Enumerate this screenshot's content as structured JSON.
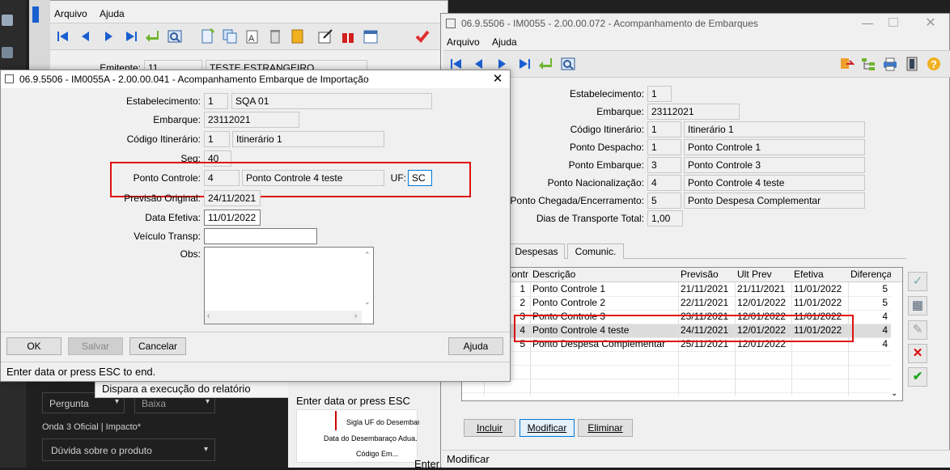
{
  "bg_window": {
    "menu": [
      "Arquivo",
      "Ajuda"
    ],
    "header_label": "Emitente:",
    "header_value": "11",
    "header_name": "TESTE ESTRANGEIRO"
  },
  "bottom_left": {
    "select1": "Pergunta",
    "select2": "Baixa",
    "section_label": "Onda 3 Oficial | Impacto*",
    "select3": "Dúvida sobre o produto",
    "tooltip": "Dispara a execução do relatório",
    "status_frag": "Enter data or press ESC",
    "flow1": "Sigla UF do Desembar...",
    "flow2": "Data do Desembaraço Adua...",
    "flow3": "Código Em...",
    "status_frag2": "Enter"
  },
  "dialog": {
    "title": "06.9.5506 - IM0055A - 2.00.00.041 - Acompanhamento Embarque de Importação",
    "labels": {
      "estab": "Estabelecimento:",
      "embarque": "Embarque:",
      "itinerario": "Código Itinerário:",
      "seq": "Seq:",
      "ponto": "Ponto Controle:",
      "uf": "UF:",
      "previsao": "Previsão Original:",
      "data_efetiva": "Data Efetiva:",
      "veiculo": "Veículo Transp:",
      "obs": "Obs:"
    },
    "values": {
      "estab_code": "1",
      "estab_name": "SQA 01",
      "embarque": "23112021",
      "itin_code": "1",
      "itin_name": "Itinerário 1",
      "seq": "40",
      "ponto_code": "4",
      "ponto_name": "Ponto Controle 4 teste",
      "uf": "SC",
      "previsao": "24/11/2021",
      "data_efetiva": "11/01/2022",
      "veiculo": "",
      "obs": ""
    },
    "buttons": {
      "ok": "OK",
      "salvar": "Salvar",
      "cancelar": "Cancelar",
      "ajuda": "Ajuda"
    },
    "status": "Enter data or press ESC to end."
  },
  "right": {
    "title": "06.9.5506 - IM0055 - 2.00.00.072 - Acompanhamento de Embarques",
    "menu": [
      "Arquivo",
      "Ajuda"
    ],
    "labels": {
      "estab": "Estabelecimento:",
      "embarque": "Embarque:",
      "itinerario": "Código Itinerário:",
      "despacho": "Ponto Despacho:",
      "pembarque": "Ponto Embarque:",
      "nacional": "Ponto Nacionalização:",
      "chegada": "Ponto Chegada/Encerramento:",
      "dias": "Dias de Transporte Total:"
    },
    "values": {
      "estab": "1",
      "embarque": "23112021",
      "itin_code": "1",
      "itin_name": "Itinerário 1",
      "desp_code": "1",
      "desp_name": "Ponto Controle 1",
      "emb_code": "3",
      "emb_name": "Ponto Controle 3",
      "nac_code": "4",
      "nac_name": "Ponto Controle 4 teste",
      "che_code": "5",
      "che_name": "Ponto Despesa Complementar",
      "dias": "1,00"
    },
    "tabs": [
      "Despesas",
      "Comunic."
    ],
    "grid": {
      "headers": [
        "Contr",
        "Descrição",
        "Previsão",
        "Ult Prev",
        "Efetiva",
        "Diferença"
      ],
      "rows": [
        [
          "1",
          "Ponto Controle 1",
          "21/11/2021",
          "21/11/2021",
          "11/01/2022",
          "5"
        ],
        [
          "2",
          "Ponto Controle 2",
          "22/11/2021",
          "12/01/2022",
          "11/01/2022",
          "5"
        ],
        [
          "3",
          "Ponto Controle 3",
          "23/11/2021",
          "12/01/2022",
          "11/01/2022",
          "4"
        ],
        [
          "4",
          "Ponto Controle 4 teste",
          "24/11/2021",
          "12/01/2022",
          "11/01/2022",
          "4"
        ],
        [
          "5",
          "Ponto Despesa Complementar",
          "25/11/2021",
          "12/01/2022",
          "",
          "4"
        ]
      ]
    },
    "buttons": {
      "incluir": "Incluir",
      "modificar": "Modificar",
      "eliminar": "Eliminar"
    },
    "status": "Modificar"
  },
  "colors": {
    "highlight": "#e01010",
    "selected_row": "#dcdcdc",
    "nav_blue": "#1a5fd0"
  }
}
